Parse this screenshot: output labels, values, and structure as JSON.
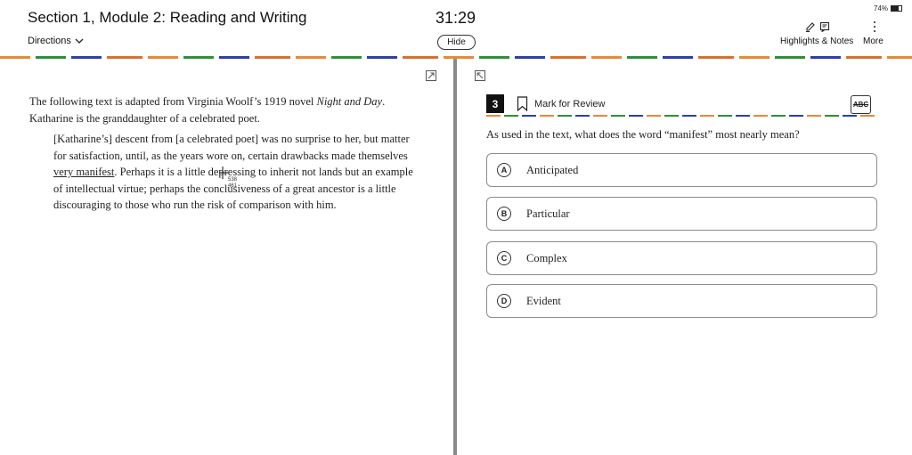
{
  "header": {
    "section_title": "Section 1, Module 2: Reading and Writing",
    "timer": "31:29",
    "battery": "74%",
    "directions_label": "Directions",
    "hide_label": "Hide",
    "highlights_label": "Highlights & Notes",
    "more_label": "More"
  },
  "passage": {
    "intro_text_1": "The following text is adapted from Virginia Woolf’s 1919 novel ",
    "intro_italic_1": "Night and Day",
    "intro_text_2": ". Katharine is the granddaughter of a celebrated poet.",
    "quote_before": "[Katharine’s] descent from [a celebrated poet] was no surprise to her, but matter for satisfaction, until, as the years wore on, certain drawbacks made themselves ",
    "quote_underlined": "very manifest",
    "quote_after": ". Perhaps it is a little depressing to inherit not lands but an example of intellectual virtue; perhaps the conclusiveness of a great ancestor is a little discouraging to those who run the risk of comparison with him.",
    "cursor_readout_1": "538",
    "cursor_readout_2": "461"
  },
  "question": {
    "number": "3",
    "mark_for_review": "Mark for Review",
    "abc_label": "ABC",
    "prompt": "As used in the text, what does the word “manifest” most nearly mean?",
    "choices": [
      {
        "letter": "A",
        "text": "Anticipated"
      },
      {
        "letter": "B",
        "text": "Particular"
      },
      {
        "letter": "C",
        "text": "Complex"
      },
      {
        "letter": "D",
        "text": "Evident"
      }
    ]
  },
  "icons": {
    "highlighter": "highlighter-icon",
    "notes": "notes-icon",
    "more": "vertical-ellipsis-icon",
    "expand_left": "expand-icon",
    "collapse_right": "collapse-icon",
    "bookmark": "bookmark-icon",
    "chevron": "chevron-down-icon"
  },
  "colors": {
    "dash_orange": "#e58a3a",
    "dash_green": "#2f8f3a",
    "dash_blue": "#2f3fa8",
    "divider": "#8a8a8a"
  }
}
